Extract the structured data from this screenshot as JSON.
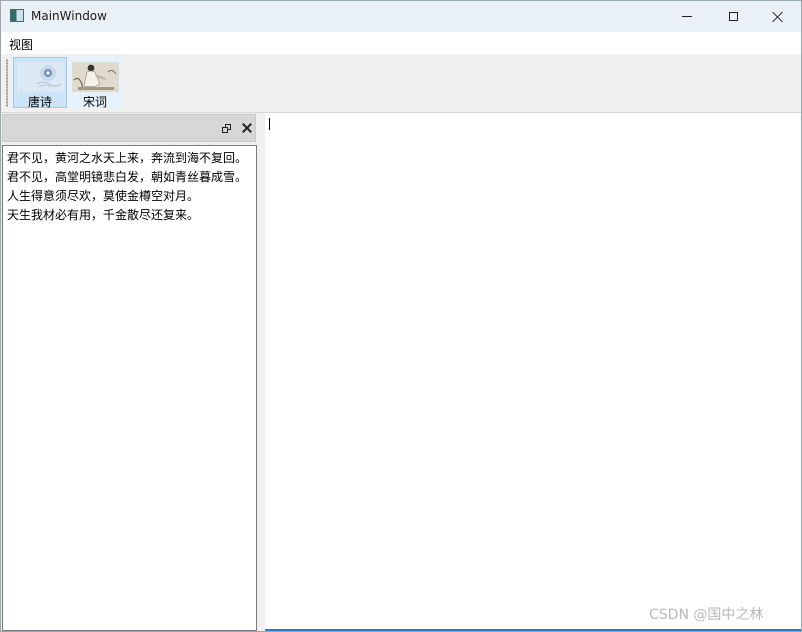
{
  "window": {
    "title": "MainWindow"
  },
  "menubar": {
    "items": [
      {
        "label": "视图"
      }
    ]
  },
  "toolbar": {
    "buttons": [
      {
        "label": "唐诗",
        "icon": "tang-poetry-icon",
        "checked": true
      },
      {
        "label": "宋词",
        "icon": "song-ci-icon",
        "checked": false
      }
    ]
  },
  "dock": {
    "lines": [
      "君不见，黄河之水天上来，奔流到海不复回。",
      "君不见，高堂明镜悲白发，朝如青丝暮成雪。",
      "人生得意须尽欢，莫使金樽空对月。",
      "天生我材必有用，千金散尽还复来。"
    ]
  },
  "watermark": {
    "text": "CSDN @国中之林"
  },
  "colors": {
    "accent": "#2f79c7",
    "checked_bg": "#cce4f7",
    "dock_header": "#d7d7d7"
  }
}
